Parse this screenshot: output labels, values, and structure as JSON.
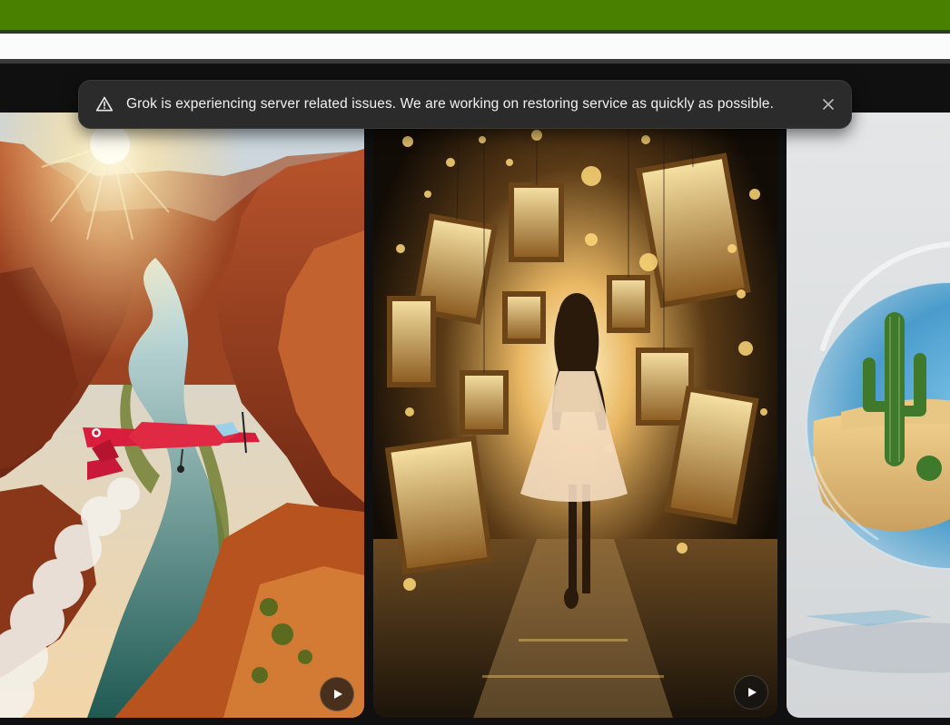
{
  "notice": {
    "message": "Grok is experiencing server related issues. We are working on restoring service as quickly as possible.",
    "warning_icon": "warning-triangle-icon",
    "close_icon": "close-icon"
  },
  "gallery": {
    "items": [
      {
        "subject": "canyon-plane",
        "play_icon": "play-icon"
      },
      {
        "subject": "woman-frames",
        "play_icon": "play-icon"
      },
      {
        "subject": "glass-sphere-cactus"
      }
    ]
  },
  "colors": {
    "browser_bar": "#4a8000",
    "toast_bg": "#2b2b2b",
    "page_bg": "#101010"
  }
}
